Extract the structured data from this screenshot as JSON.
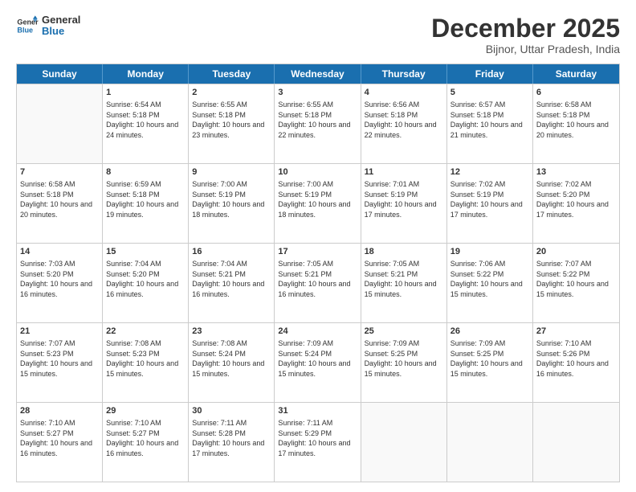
{
  "logo": {
    "line1": "General",
    "line2": "Blue"
  },
  "title": "December 2025",
  "subtitle": "Bijnor, Uttar Pradesh, India",
  "days": [
    "Sunday",
    "Monday",
    "Tuesday",
    "Wednesday",
    "Thursday",
    "Friday",
    "Saturday"
  ],
  "weeks": [
    [
      {
        "day": "",
        "sunrise": "",
        "sunset": "",
        "daylight": ""
      },
      {
        "day": "1",
        "sunrise": "Sunrise: 6:54 AM",
        "sunset": "Sunset: 5:18 PM",
        "daylight": "Daylight: 10 hours and 24 minutes."
      },
      {
        "day": "2",
        "sunrise": "Sunrise: 6:55 AM",
        "sunset": "Sunset: 5:18 PM",
        "daylight": "Daylight: 10 hours and 23 minutes."
      },
      {
        "day": "3",
        "sunrise": "Sunrise: 6:55 AM",
        "sunset": "Sunset: 5:18 PM",
        "daylight": "Daylight: 10 hours and 22 minutes."
      },
      {
        "day": "4",
        "sunrise": "Sunrise: 6:56 AM",
        "sunset": "Sunset: 5:18 PM",
        "daylight": "Daylight: 10 hours and 22 minutes."
      },
      {
        "day": "5",
        "sunrise": "Sunrise: 6:57 AM",
        "sunset": "Sunset: 5:18 PM",
        "daylight": "Daylight: 10 hours and 21 minutes."
      },
      {
        "day": "6",
        "sunrise": "Sunrise: 6:58 AM",
        "sunset": "Sunset: 5:18 PM",
        "daylight": "Daylight: 10 hours and 20 minutes."
      }
    ],
    [
      {
        "day": "7",
        "sunrise": "Sunrise: 6:58 AM",
        "sunset": "Sunset: 5:18 PM",
        "daylight": "Daylight: 10 hours and 20 minutes."
      },
      {
        "day": "8",
        "sunrise": "Sunrise: 6:59 AM",
        "sunset": "Sunset: 5:18 PM",
        "daylight": "Daylight: 10 hours and 19 minutes."
      },
      {
        "day": "9",
        "sunrise": "Sunrise: 7:00 AM",
        "sunset": "Sunset: 5:19 PM",
        "daylight": "Daylight: 10 hours and 18 minutes."
      },
      {
        "day": "10",
        "sunrise": "Sunrise: 7:00 AM",
        "sunset": "Sunset: 5:19 PM",
        "daylight": "Daylight: 10 hours and 18 minutes."
      },
      {
        "day": "11",
        "sunrise": "Sunrise: 7:01 AM",
        "sunset": "Sunset: 5:19 PM",
        "daylight": "Daylight: 10 hours and 17 minutes."
      },
      {
        "day": "12",
        "sunrise": "Sunrise: 7:02 AM",
        "sunset": "Sunset: 5:19 PM",
        "daylight": "Daylight: 10 hours and 17 minutes."
      },
      {
        "day": "13",
        "sunrise": "Sunrise: 7:02 AM",
        "sunset": "Sunset: 5:20 PM",
        "daylight": "Daylight: 10 hours and 17 minutes."
      }
    ],
    [
      {
        "day": "14",
        "sunrise": "Sunrise: 7:03 AM",
        "sunset": "Sunset: 5:20 PM",
        "daylight": "Daylight: 10 hours and 16 minutes."
      },
      {
        "day": "15",
        "sunrise": "Sunrise: 7:04 AM",
        "sunset": "Sunset: 5:20 PM",
        "daylight": "Daylight: 10 hours and 16 minutes."
      },
      {
        "day": "16",
        "sunrise": "Sunrise: 7:04 AM",
        "sunset": "Sunset: 5:21 PM",
        "daylight": "Daylight: 10 hours and 16 minutes."
      },
      {
        "day": "17",
        "sunrise": "Sunrise: 7:05 AM",
        "sunset": "Sunset: 5:21 PM",
        "daylight": "Daylight: 10 hours and 16 minutes."
      },
      {
        "day": "18",
        "sunrise": "Sunrise: 7:05 AM",
        "sunset": "Sunset: 5:21 PM",
        "daylight": "Daylight: 10 hours and 15 minutes."
      },
      {
        "day": "19",
        "sunrise": "Sunrise: 7:06 AM",
        "sunset": "Sunset: 5:22 PM",
        "daylight": "Daylight: 10 hours and 15 minutes."
      },
      {
        "day": "20",
        "sunrise": "Sunrise: 7:07 AM",
        "sunset": "Sunset: 5:22 PM",
        "daylight": "Daylight: 10 hours and 15 minutes."
      }
    ],
    [
      {
        "day": "21",
        "sunrise": "Sunrise: 7:07 AM",
        "sunset": "Sunset: 5:23 PM",
        "daylight": "Daylight: 10 hours and 15 minutes."
      },
      {
        "day": "22",
        "sunrise": "Sunrise: 7:08 AM",
        "sunset": "Sunset: 5:23 PM",
        "daylight": "Daylight: 10 hours and 15 minutes."
      },
      {
        "day": "23",
        "sunrise": "Sunrise: 7:08 AM",
        "sunset": "Sunset: 5:24 PM",
        "daylight": "Daylight: 10 hours and 15 minutes."
      },
      {
        "day": "24",
        "sunrise": "Sunrise: 7:09 AM",
        "sunset": "Sunset: 5:24 PM",
        "daylight": "Daylight: 10 hours and 15 minutes."
      },
      {
        "day": "25",
        "sunrise": "Sunrise: 7:09 AM",
        "sunset": "Sunset: 5:25 PM",
        "daylight": "Daylight: 10 hours and 15 minutes."
      },
      {
        "day": "26",
        "sunrise": "Sunrise: 7:09 AM",
        "sunset": "Sunset: 5:25 PM",
        "daylight": "Daylight: 10 hours and 15 minutes."
      },
      {
        "day": "27",
        "sunrise": "Sunrise: 7:10 AM",
        "sunset": "Sunset: 5:26 PM",
        "daylight": "Daylight: 10 hours and 16 minutes."
      }
    ],
    [
      {
        "day": "28",
        "sunrise": "Sunrise: 7:10 AM",
        "sunset": "Sunset: 5:27 PM",
        "daylight": "Daylight: 10 hours and 16 minutes."
      },
      {
        "day": "29",
        "sunrise": "Sunrise: 7:10 AM",
        "sunset": "Sunset: 5:27 PM",
        "daylight": "Daylight: 10 hours and 16 minutes."
      },
      {
        "day": "30",
        "sunrise": "Sunrise: 7:11 AM",
        "sunset": "Sunset: 5:28 PM",
        "daylight": "Daylight: 10 hours and 17 minutes."
      },
      {
        "day": "31",
        "sunrise": "Sunrise: 7:11 AM",
        "sunset": "Sunset: 5:29 PM",
        "daylight": "Daylight: 10 hours and 17 minutes."
      },
      {
        "day": "",
        "sunrise": "",
        "sunset": "",
        "daylight": ""
      },
      {
        "day": "",
        "sunrise": "",
        "sunset": "",
        "daylight": ""
      },
      {
        "day": "",
        "sunrise": "",
        "sunset": "",
        "daylight": ""
      }
    ]
  ]
}
